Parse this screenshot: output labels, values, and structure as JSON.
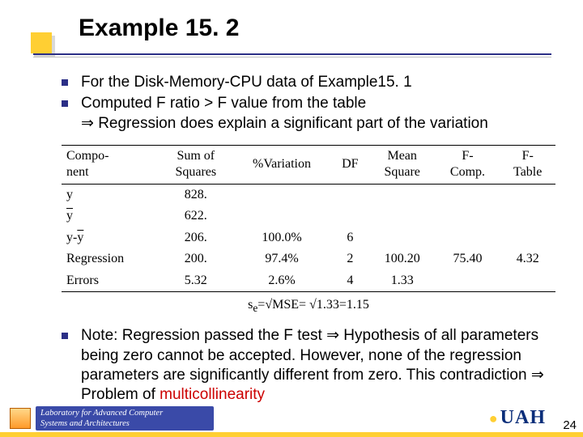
{
  "title": "Example 15. 2",
  "bullets": {
    "b1": "For the Disk-Memory-CPU data of Example15. 1",
    "b2_line1": " Computed F ratio > F value from the table",
    "b2_line2_prefix": "  ",
    "implies": "⇒",
    "b2_line2_rest": " Regression does explain a significant part of the variation",
    "b3_a": "Note: Regression passed the F test ",
    "b3_b": " Hypothesis of all parameters being zero cannot be accepted. However, none of the regression parameters are significantly different from zero. This contradiction ",
    "b3_c": " Problem of ",
    "b3_hl": "multicollinearity"
  },
  "table": {
    "headers": {
      "component": "Compo-\nnent",
      "ss": "Sum of\nSquares",
      "pctvar": "%Variation",
      "df": "DF",
      "ms": "Mean\nSquare",
      "fcomp": "F-\nComp.",
      "ftable": "F-\nTable"
    },
    "rows": [
      {
        "component": "y",
        "ss": "828.",
        "pctvar": "",
        "df": "",
        "ms": "",
        "fcomp": "",
        "ftable": ""
      },
      {
        "component": "ȳ",
        "ss": "622.",
        "pctvar": "",
        "df": "",
        "ms": "",
        "fcomp": "",
        "ftable": ""
      },
      {
        "component": "y-ȳ",
        "ss": "206.",
        "pctvar": "100.0%",
        "df": "6",
        "ms": "",
        "fcomp": "",
        "ftable": ""
      },
      {
        "component": "Regression",
        "ss": "200.",
        "pctvar": "97.4%",
        "df": "2",
        "ms": "100.20",
        "fcomp": "75.40",
        "ftable": "4.32"
      },
      {
        "component": "Errors",
        "ss": "5.32",
        "pctvar": "2.6%",
        "df": "4",
        "ms": "1.33",
        "fcomp": "",
        "ftable": ""
      }
    ]
  },
  "se": {
    "label": "s_e=",
    "sqrt1": "√MSE",
    "eq": "= ",
    "sqrt2": "√1.33",
    "val": "=1.15"
  },
  "footer": {
    "lab_line1": "Laboratory for Advanced Computer",
    "lab_line2": "Systems and Architectures",
    "uah": "UAH",
    "page": "24"
  },
  "chart_data": {
    "type": "table",
    "title": "ANOVA table for Example 15.2",
    "columns": [
      "Component",
      "Sum of Squares",
      "%Variation",
      "DF",
      "Mean Square",
      "F-Comp.",
      "F-Table"
    ],
    "rows": [
      [
        "y",
        828.0,
        null,
        null,
        null,
        null,
        null
      ],
      [
        "ȳ",
        622.0,
        null,
        null,
        null,
        null,
        null
      ],
      [
        "y-ȳ",
        206.0,
        100.0,
        6,
        null,
        null,
        null
      ],
      [
        "Regression",
        200.0,
        97.4,
        2,
        100.2,
        75.4,
        4.32
      ],
      [
        "Errors",
        5.32,
        2.6,
        4,
        1.33,
        null,
        null
      ]
    ],
    "derived": {
      "s_e": 1.15,
      "MSE": 1.33
    }
  }
}
